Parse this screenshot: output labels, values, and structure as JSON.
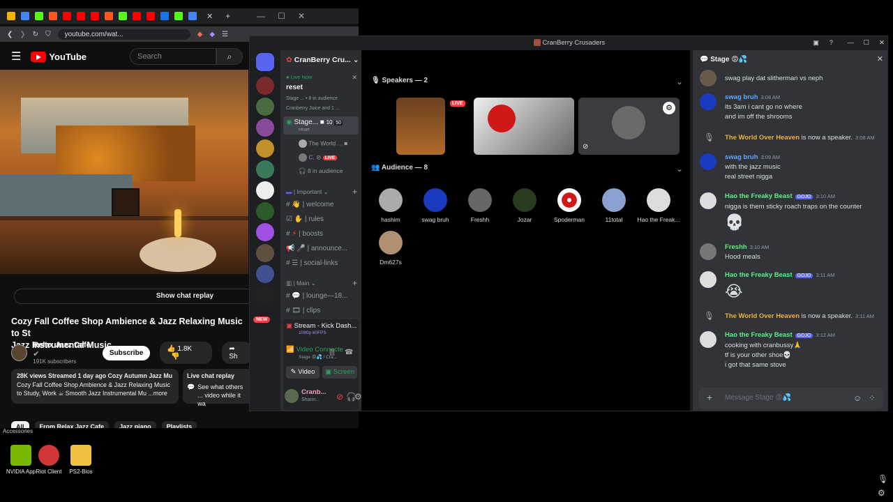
{
  "browser": {
    "url": "youtube.com/wat...",
    "yt": {
      "logo": "YouTube",
      "search_placeholder": "Search"
    },
    "show_chat_replay": "Show chat replay",
    "video_title": "Cozy Fall Coffee Shop Ambience & Jazz Relaxing Music to St... Jazz Instrumental Music",
    "title_line1": "Cozy Fall Coffee Shop Ambience & Jazz Relaxing Music to St",
    "title_line2": "Jazz Instrumental Music",
    "channel_name": "Relax Jazz Cafe",
    "subscribers": "191K subscribers",
    "subscribe": "Subscribe",
    "likes": "1.8K",
    "share": "Sh",
    "desc_line1": "28K views  Streamed 1 day ago  Cozy Autumn Jazz Mu",
    "desc_line2": "Cozy Fall Coffee Shop Ambience & Jazz Relaxing Music",
    "desc_line3": "to Study, Work ☕ Smooth Jazz Instrumental Mu ...more",
    "livechat_title": "Live chat replay",
    "livechat_text": "See what others ... video while it wa",
    "chips": [
      "All",
      "From Relax Jazz Cafe",
      "Jazz piano",
      "Playlists"
    ]
  },
  "desktop": {
    "label": "Accessories",
    "icons": [
      {
        "label": "NVIDIA App",
        "color": "#76b900"
      },
      {
        "label": "Riot Client",
        "color": "#d13639"
      },
      {
        "label": "PS2-Bios",
        "color": "#f0c040"
      }
    ]
  },
  "discord": {
    "window_title": "CranBerry Crusaders",
    "server_name": "CranBerry Cru...",
    "live_now": "Live Now",
    "reset": "reset",
    "stage_meta": "Stage ...  • 8 in audience",
    "stage_sub": "Cranberry Juice and 1 ...",
    "stage_channel": "Stage...",
    "stage_count": "10",
    "stage_limit": "50",
    "stage_reset": "reset",
    "the_world": "The World ...",
    "c_user": "C.",
    "live_badge": "LIVE",
    "in_audience": "8 in audience",
    "cat_important": "| Important",
    "channels": [
      "| welcome",
      "| rules",
      "| boosts",
      "| announce...",
      "| social-links"
    ],
    "cat_main": "| Main",
    "channels_main": [
      "| lounge—18...",
      "| clips"
    ],
    "new_badge": "NEW",
    "stream_title": "Stream - Kick Dash...",
    "stream_quality": "1080p 60FPS",
    "video_connected": "Video Connecte",
    "vc_sub": "Stage 😡💦 / Cra...",
    "video_btn": "Video",
    "screen_btn": "Screen",
    "user_name": "Cranb...",
    "user_status": "Sharin...",
    "speakers_title": "Speakers — 2",
    "audience_title": "Audience — 8",
    "audience": [
      "hashim",
      "swag bruh",
      "Freshh",
      "Jozar",
      "Spoderman",
      "11total",
      "Hao the Freak...",
      "Dm627s"
    ],
    "chat_title": "Stage 😡💦",
    "messages": [
      {
        "text": "swag play dat slitherman vs neph"
      },
      {
        "author": "swag bruh",
        "time": "3:08 AM",
        "lines": [
          "its 3am i cant go no where",
          "and im off the shrooms"
        ]
      },
      {
        "system": "The World Over Heaven",
        "rest": " is now a speaker.",
        "time": "3:08 AM"
      },
      {
        "author": "swag bruh",
        "time": "3:09 AM",
        "lines": [
          "with the jazz music",
          "real street nigga"
        ]
      },
      {
        "author": "Hao the Freaky Beast",
        "tag": "GOJO",
        "time": "3:10 AM",
        "lines": [
          "nigga is them sticky roach traps on the counter",
          "💀"
        ]
      },
      {
        "author": "Freshh",
        "time": "3:10 AM",
        "lines": [
          "Hood meals"
        ]
      },
      {
        "author": "Hao the Freaky Beast",
        "tag": "GOJO",
        "time": "3:11 AM",
        "lines": [
          "😭"
        ]
      },
      {
        "system": "The World Over Heaven",
        "rest": " is now a speaker.",
        "time": "3:11 AM"
      },
      {
        "author": "Hao the Freaky Beast",
        "tag": "GOJO",
        "time": "3:12 AM",
        "lines": [
          "cooking with cranbussy🙏",
          "tf is your other shoe💀",
          "i got that same stove"
        ]
      }
    ],
    "composer_placeholder": "Message Stage 😡💦",
    "colors": {
      "accent": "#5865f2",
      "green": "#23a55a",
      "live": "#ed4245",
      "author_blue": "#5ca8ff",
      "author_green": "#57f287",
      "system": "#f0b232"
    }
  }
}
